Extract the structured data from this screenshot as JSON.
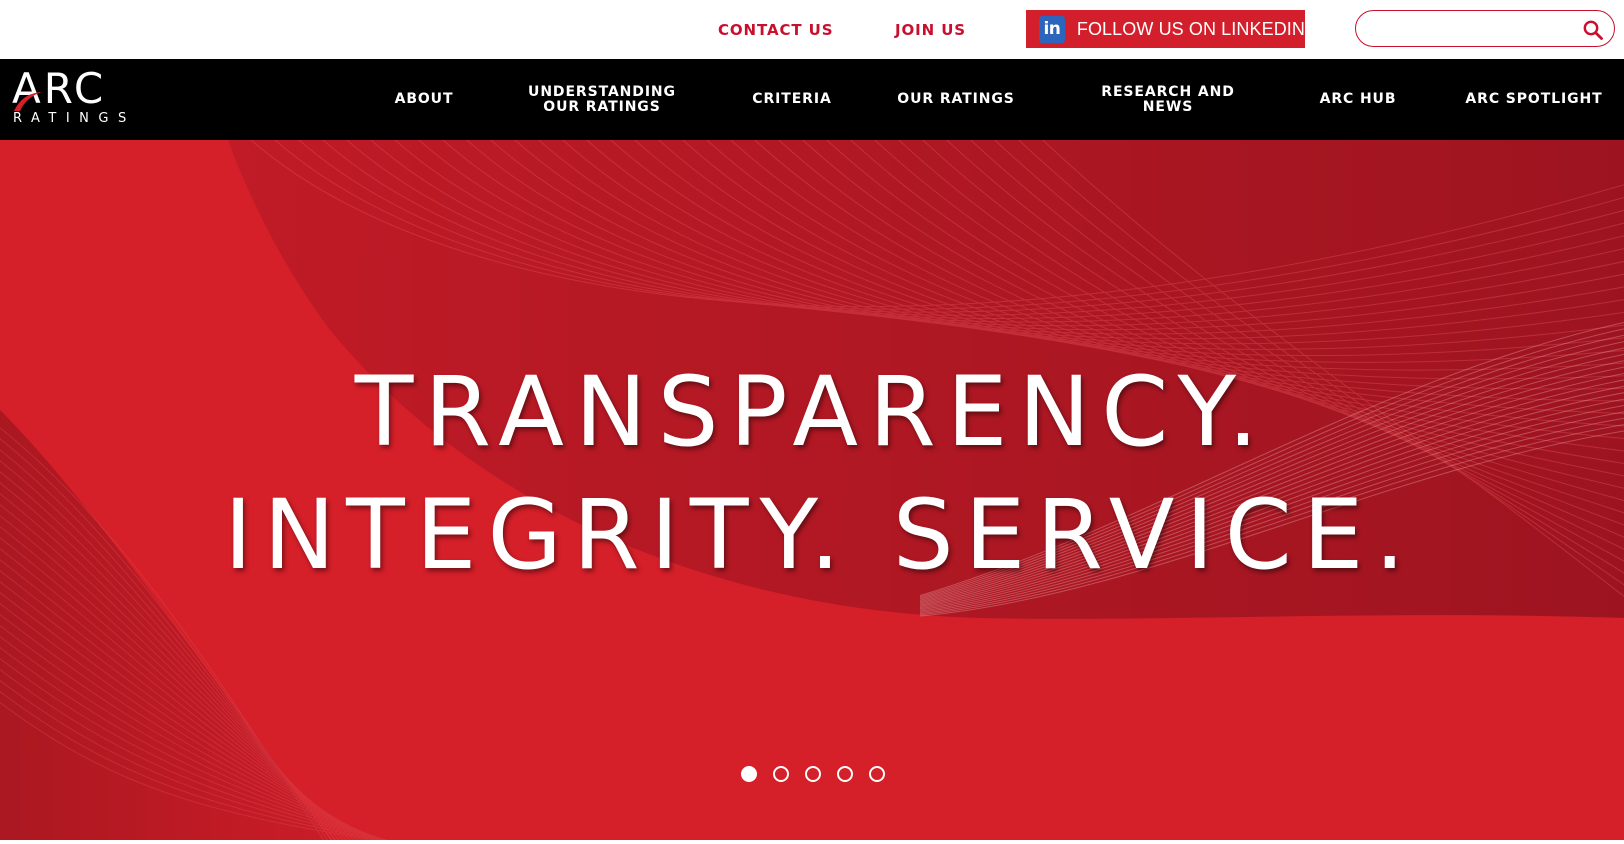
{
  "utility": {
    "contact_label": "CONTACT US",
    "join_label": "JOIN US",
    "linkedin_icon_text": "in",
    "linkedin_label": "FOLLOW US ON LINKEDIN",
    "search_placeholder": "",
    "search_value": ""
  },
  "logo": {
    "brand": "ARC",
    "tagline": "RATINGS"
  },
  "nav": {
    "items": [
      {
        "label": "ABOUT"
      },
      {
        "label": "UNDERSTANDING\nOUR RATINGS"
      },
      {
        "label": "CRITERIA"
      },
      {
        "label": "OUR RATINGS"
      },
      {
        "label": "RESEARCH AND\nNEWS"
      },
      {
        "label": "ARC HUB"
      },
      {
        "label": "ARC SPOTLIGHT"
      }
    ]
  },
  "hero": {
    "line1": "TRANSPARENCY.",
    "line2": "INTEGRITY. SERVICE.",
    "slide_count": 5,
    "active_slide": 1
  },
  "colors": {
    "brand_red": "#c8102e",
    "hero_red": "#d51f29",
    "linkedin_bg": "#d31f2b",
    "linkedin_icon": "#2d64bc",
    "nav_bg": "#000000"
  },
  "icons": {
    "linkedin": "linkedin-icon",
    "search": "search-icon",
    "logo_swoosh": "logo-swoosh-icon"
  }
}
